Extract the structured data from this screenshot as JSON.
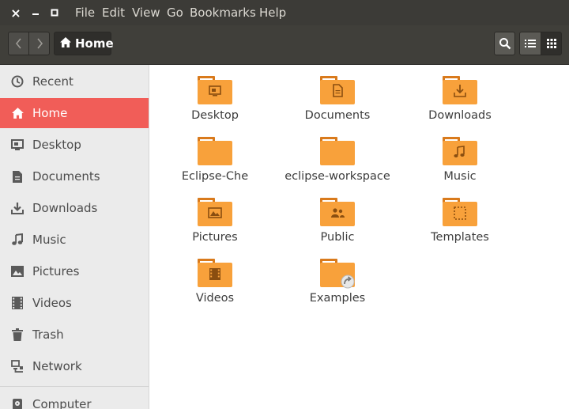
{
  "window": {
    "close_glyph": "×",
    "minimize_glyph": "–",
    "maximize_glyph": "□"
  },
  "menu": {
    "items": [
      "File",
      "Edit",
      "View",
      "Go",
      "Bookmarks",
      "Help"
    ]
  },
  "toolbar": {
    "path_label": "Home"
  },
  "sidebar": {
    "items": [
      {
        "label": "Recent",
        "icon": "clock-icon",
        "active": false
      },
      {
        "label": "Home",
        "icon": "home-icon",
        "active": true
      },
      {
        "label": "Desktop",
        "icon": "desktop-icon",
        "active": false
      },
      {
        "label": "Documents",
        "icon": "document-icon",
        "active": false
      },
      {
        "label": "Downloads",
        "icon": "download-icon",
        "active": false
      },
      {
        "label": "Music",
        "icon": "music-icon",
        "active": false
      },
      {
        "label": "Pictures",
        "icon": "picture-icon",
        "active": false
      },
      {
        "label": "Videos",
        "icon": "film-icon",
        "active": false
      },
      {
        "label": "Trash",
        "icon": "trash-icon",
        "active": false
      },
      {
        "label": "Network",
        "icon": "network-icon",
        "active": false
      },
      {
        "label": "Computer",
        "icon": "computer-icon",
        "active": false
      }
    ]
  },
  "files": [
    {
      "label": "Desktop",
      "emblem": "desktop"
    },
    {
      "label": "Documents",
      "emblem": "document"
    },
    {
      "label": "Downloads",
      "emblem": "download"
    },
    {
      "label": "Eclipse-Che",
      "emblem": "none"
    },
    {
      "label": "eclipse-workspace",
      "emblem": "none"
    },
    {
      "label": "Music",
      "emblem": "music"
    },
    {
      "label": "Pictures",
      "emblem": "picture"
    },
    {
      "label": "Public",
      "emblem": "people"
    },
    {
      "label": "Templates",
      "emblem": "template"
    },
    {
      "label": "Videos",
      "emblem": "film"
    },
    {
      "label": "Examples",
      "emblem": "link"
    }
  ],
  "colors": {
    "accent": "#f15d58",
    "folder": "#f8a13b",
    "titlebar": "#3c3b37"
  }
}
